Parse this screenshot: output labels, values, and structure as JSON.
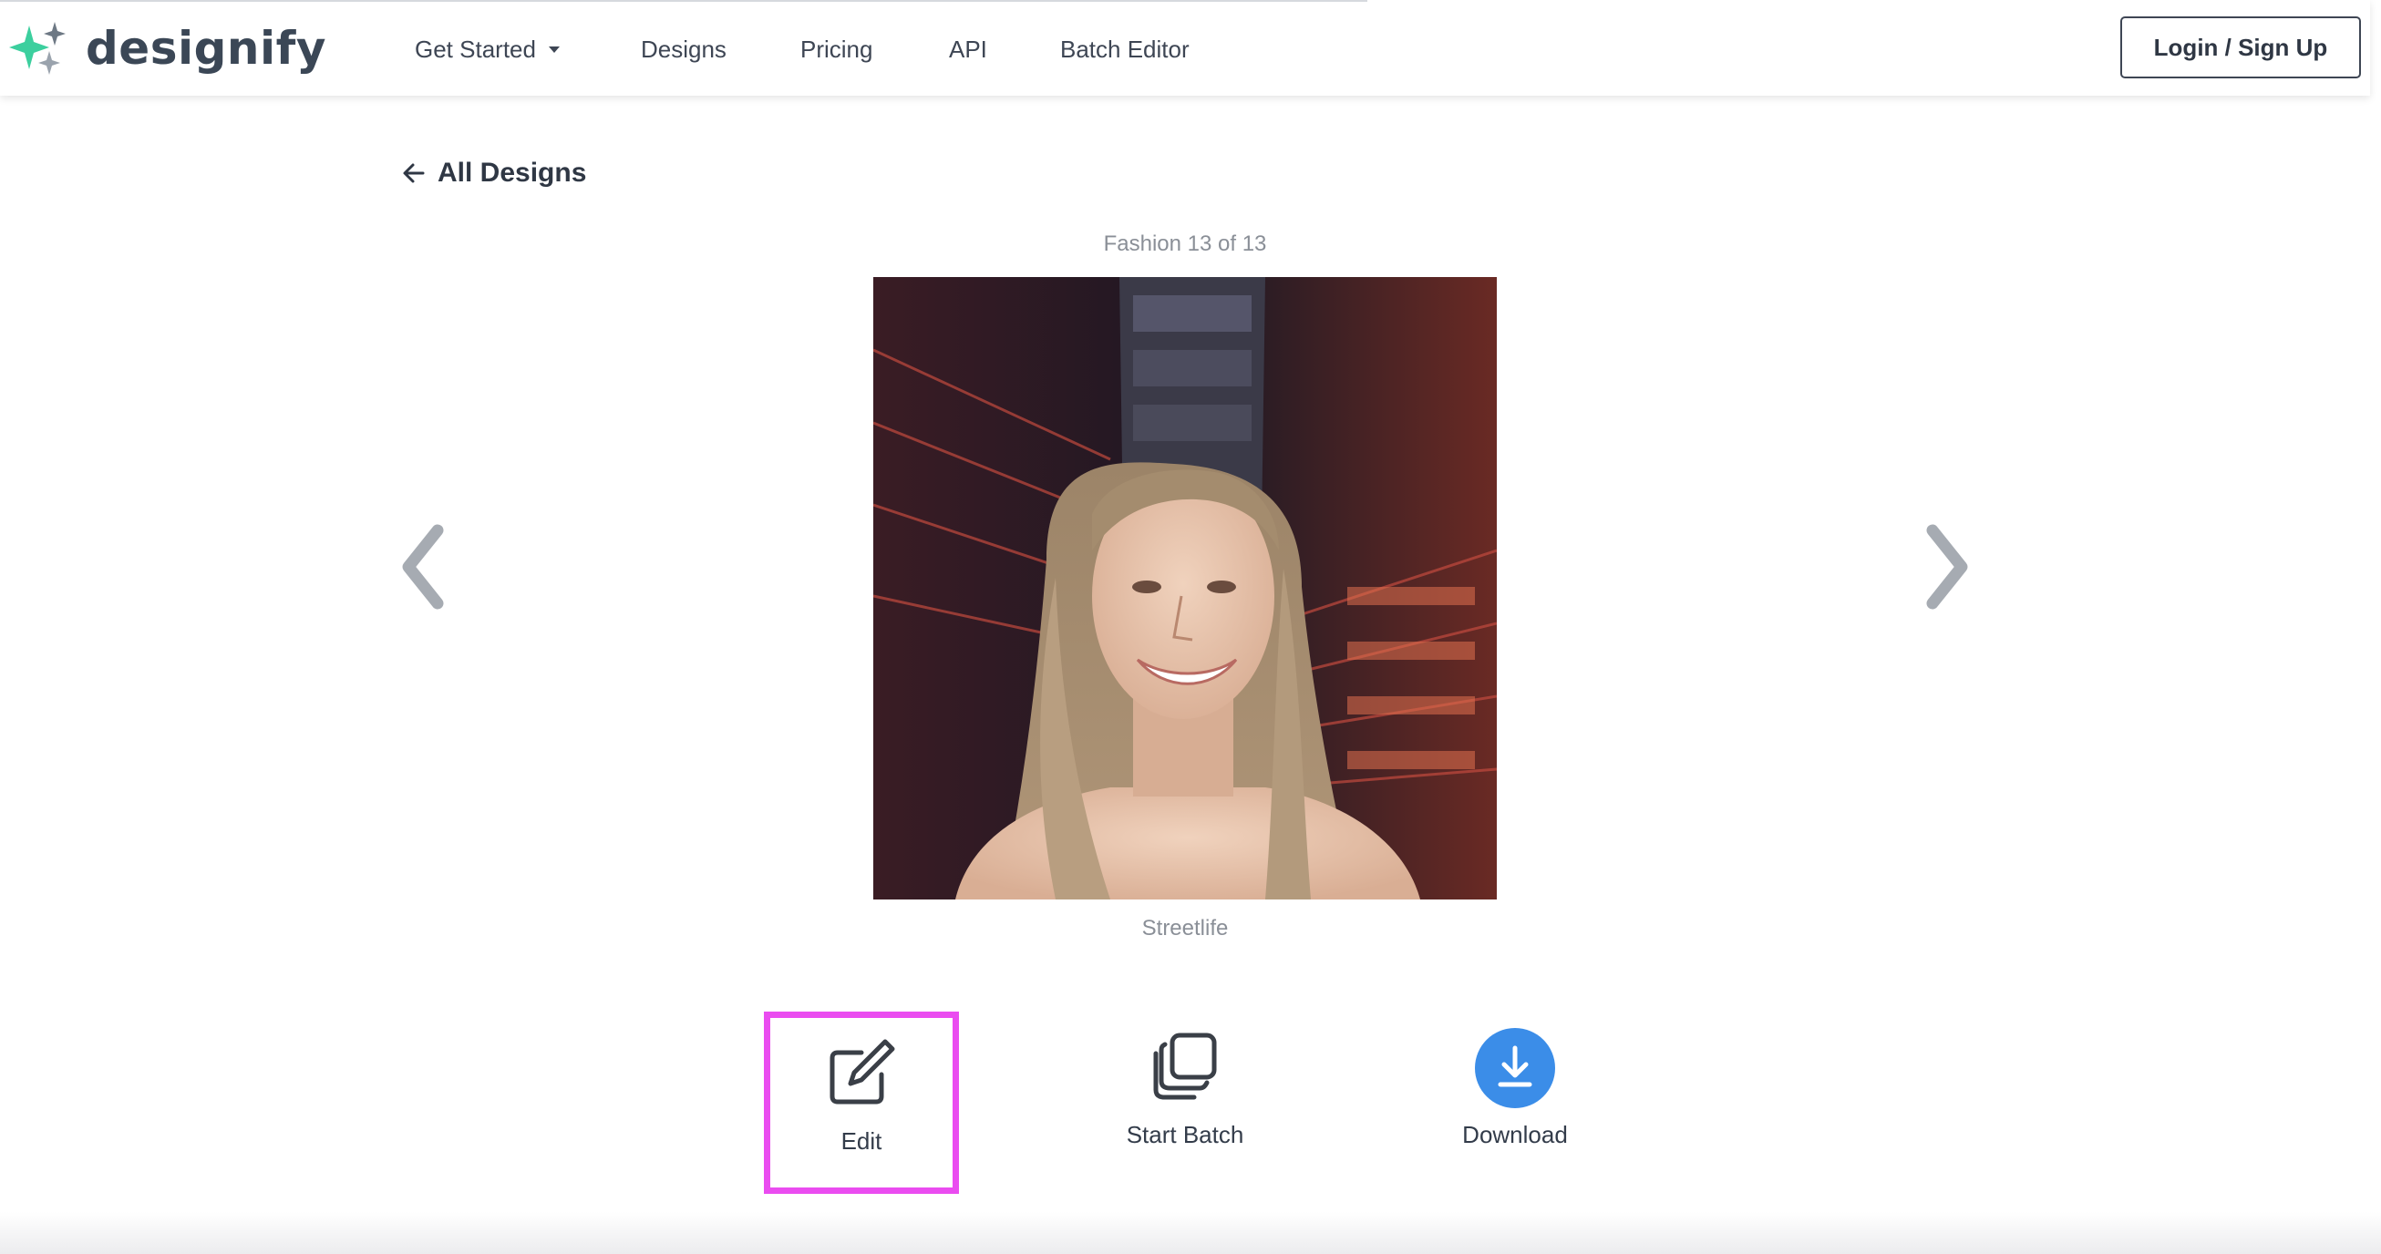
{
  "brand": {
    "name": "designify",
    "accent": "#3ccf9e"
  },
  "nav": {
    "items": [
      {
        "label": "Get Started",
        "has_dropdown": true
      },
      {
        "label": "Designs"
      },
      {
        "label": "Pricing"
      },
      {
        "label": "API"
      },
      {
        "label": "Batch Editor"
      }
    ],
    "login_label": "Login / Sign Up"
  },
  "back": {
    "label": "All Designs",
    "icon": "arrow-left-icon"
  },
  "viewer": {
    "counter": "Fashion 13 of 13",
    "image_name": "Streetlife",
    "prev_icon": "chevron-left-icon",
    "next_icon": "chevron-right-icon"
  },
  "actions": [
    {
      "label": "Edit",
      "icon": "edit-icon",
      "highlighted": true,
      "highlight_color": "#ea4cf0"
    },
    {
      "label": "Start Batch",
      "icon": "stack-icon"
    },
    {
      "label": "Download",
      "icon": "download-icon",
      "icon_bg": "#3b8de8"
    }
  ]
}
